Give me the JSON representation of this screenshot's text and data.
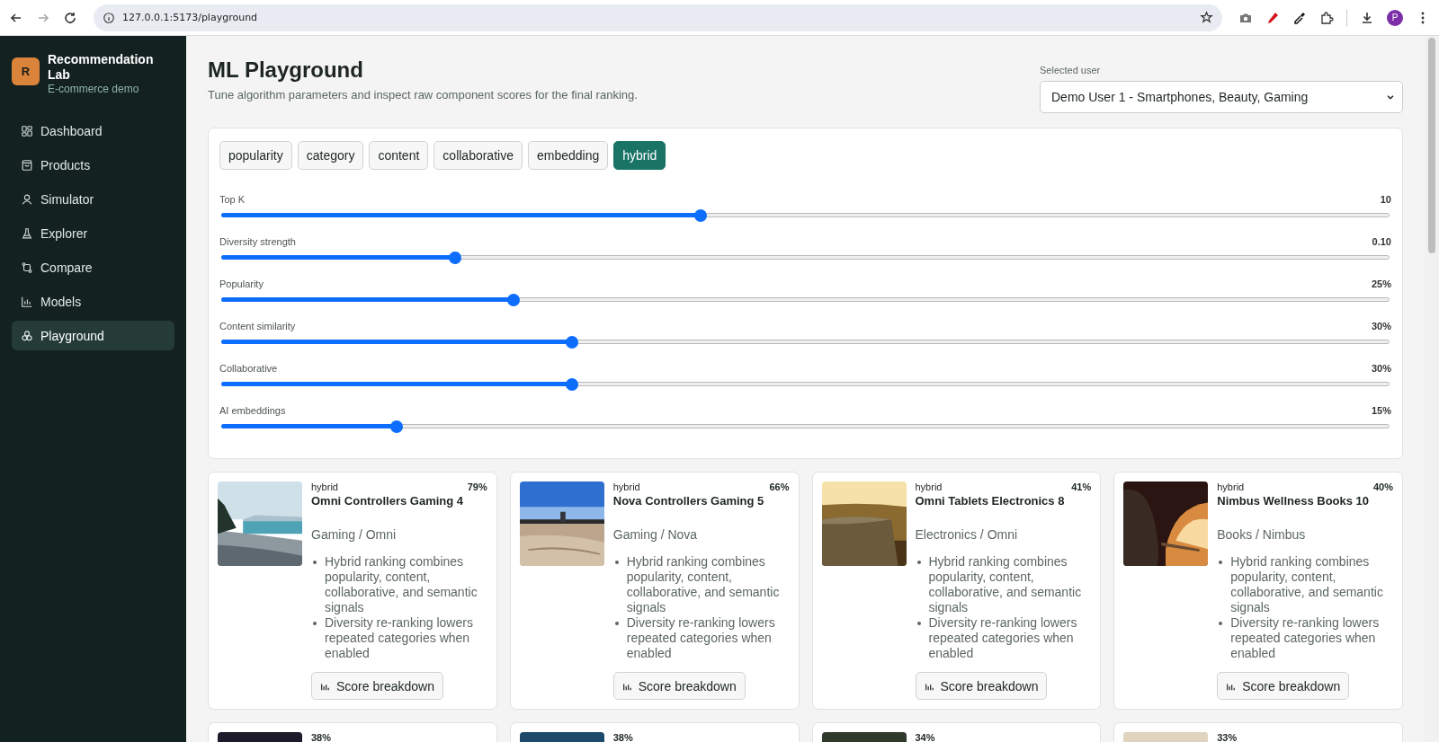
{
  "browser": {
    "url": "127.0.0.1:5173/playground",
    "avatar": "P"
  },
  "sidebar": {
    "logo": "R",
    "title": "Recommendation Lab",
    "subtitle": "E-commerce demo",
    "items": [
      {
        "label": "Dashboard",
        "selected": false
      },
      {
        "label": "Products",
        "selected": false
      },
      {
        "label": "Simulator",
        "selected": false
      },
      {
        "label": "Explorer",
        "selected": false
      },
      {
        "label": "Compare",
        "selected": false
      },
      {
        "label": "Models",
        "selected": false
      },
      {
        "label": "Playground",
        "selected": true
      }
    ]
  },
  "header": {
    "title": "ML Playground",
    "subtitle": "Tune algorithm parameters and inspect raw component scores for the final ranking.",
    "user_select": {
      "label": "Selected user",
      "value": "Demo User 1 - Smartphones, Beauty, Gaming"
    }
  },
  "algorithm_tabs": [
    {
      "label": "popularity",
      "selected": false
    },
    {
      "label": "category",
      "selected": false
    },
    {
      "label": "content",
      "selected": false
    },
    {
      "label": "collaborative",
      "selected": false
    },
    {
      "label": "embedding",
      "selected": false
    },
    {
      "label": "hybrid",
      "selected": true
    }
  ],
  "sliders": [
    {
      "label": "Top K",
      "reading": "10",
      "level": 0.41
    },
    {
      "label": "Diversity strength",
      "reading": "0.10",
      "level": 0.2
    },
    {
      "label": "Popularity",
      "reading": "25%",
      "level": 0.25
    },
    {
      "label": "Content similarity",
      "reading": "30%",
      "level": 0.3
    },
    {
      "label": "Collaborative",
      "reading": "30%",
      "level": 0.3
    },
    {
      "label": "AI embeddings",
      "reading": "15%",
      "level": 0.15
    }
  ],
  "cards": [
    {
      "algorithm": "hybrid",
      "score": "79%",
      "name": "Omni Controllers Gaming 4",
      "category": "Gaming / Omni",
      "bullets": [
        "Hybrid ranking combines popularity, content, collaborative, and semantic signals",
        "Diversity re-ranking lowers repeated categories when enabled"
      ],
      "button": "Score breakdown"
    },
    {
      "algorithm": "hybrid",
      "score": "66%",
      "name": "Nova Controllers Gaming 5",
      "category": "Gaming / Nova",
      "bullets": [
        "Hybrid ranking combines popularity, content, collaborative, and semantic signals",
        "Diversity re-ranking lowers repeated categories when enabled"
      ],
      "button": "Score breakdown"
    },
    {
      "algorithm": "hybrid",
      "score": "41%",
      "name": "Omni Tablets Electronics 8",
      "category": "Electronics / Omni",
      "bullets": [
        "Hybrid ranking combines popularity, content, collaborative, and semantic signals",
        "Diversity re-ranking lowers repeated categories when enabled"
      ],
      "button": "Score breakdown"
    },
    {
      "algorithm": "hybrid",
      "score": "40%",
      "name": "Nimbus Wellness Books 10",
      "category": "Books / Nimbus",
      "bullets": [
        "Hybrid ranking combines popularity, content, collaborative, and semantic signals",
        "Diversity re-ranking lowers repeated categories when enabled"
      ],
      "button": "Score breakdown"
    },
    {
      "score": "38%"
    },
    {
      "score": "38%"
    },
    {
      "score": "34%"
    },
    {
      "score": "33%"
    }
  ]
}
